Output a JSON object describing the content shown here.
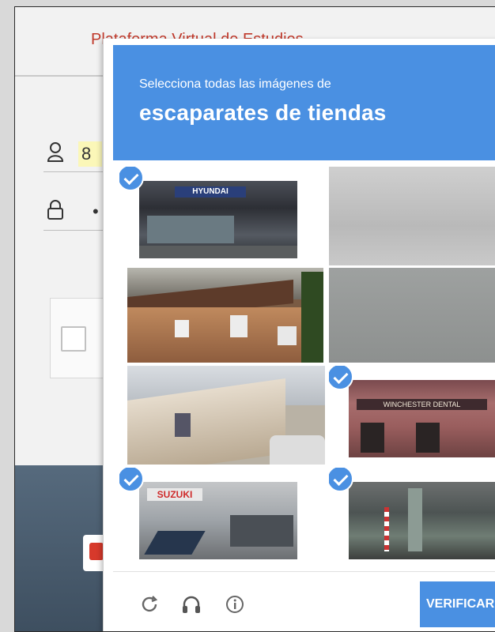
{
  "background_page": {
    "title": "Plataforma Virtual de Estudios",
    "username_value": "8",
    "password_value": "•"
  },
  "captcha": {
    "instruction_prefix": "Selecciona todas las imágenes de",
    "instruction_target": "escaparates de tiendas",
    "tiles": [
      {
        "scene": "Hyundai dealership storefront",
        "selected": true
      },
      {
        "scene": "Gray overcast sky",
        "selected": false
      },
      {
        "scene": "Brown brick residential building",
        "selected": false
      },
      {
        "scene": "Gray sky",
        "selected": false
      },
      {
        "scene": "White stucco building with cars",
        "selected": false
      },
      {
        "scene": "Winchester Dental storefront",
        "selected": true
      },
      {
        "scene": "Suzuki dealership storefront",
        "selected": true
      },
      {
        "scene": "Street storefront with barber pole",
        "selected": true
      }
    ],
    "storefront_signs": {
      "hyundai": "HYUNDAI",
      "winchester": "WINCHESTER DENTAL",
      "suzuki": "SUZUKI"
    },
    "footer": {
      "reload_icon": "reload-icon",
      "audio_icon": "headphones-icon",
      "info_icon": "info-icon",
      "verify_label": "VERIFICAR"
    }
  },
  "colors": {
    "accent": "#4a90e2",
    "background_title": "#c0392b"
  }
}
